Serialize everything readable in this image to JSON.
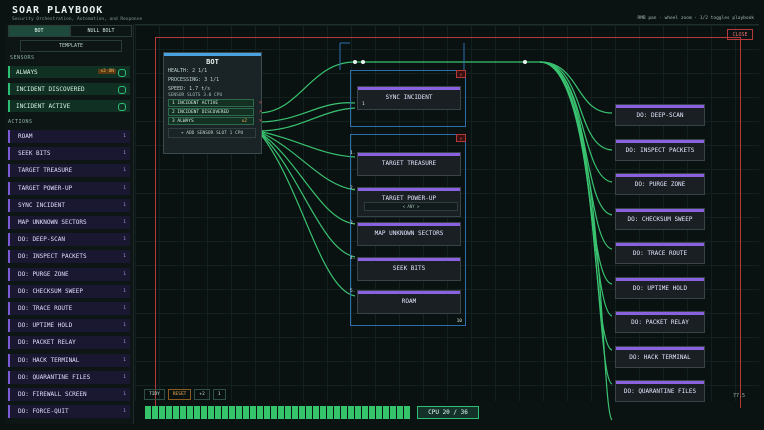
{
  "header": {
    "title": "SOAR PLAYBOOK",
    "subtitle": "Security Orchestration, Automation, and Response",
    "right": "RMB pan · wheel zoom · 1/2 toggles playbook",
    "close": "CLOSE"
  },
  "left": {
    "tabs": [
      "BOT",
      "NULL BOLT"
    ],
    "template": "TEMPLATE",
    "sensors_label": "SENSORS",
    "sensors": [
      {
        "label": "ALWAYS",
        "badge": "x2 ON"
      },
      {
        "label": "INCIDENT DISCOVERED"
      },
      {
        "label": "INCIDENT ACTIVE"
      }
    ],
    "actions_label": "ACTIONS",
    "actions": [
      "ROAM",
      "SEEK BITS",
      "TARGET TREASURE",
      "TARGET POWER-UP",
      "SYNC INCIDENT",
      "MAP UNKNOWN SECTORS",
      "DO: DEEP-SCAN",
      "DO: INSPECT PACKETS",
      "DO: PURGE ZONE",
      "DO: CHECKSUM SWEEP",
      "DO: TRACE ROUTE",
      "DO: UPTIME HOLD",
      "DO: PACKET RELAY",
      "DO: HACK TERMINAL",
      "DO: QUARANTINE FILES",
      "DO: FIREWALL SCREEN",
      "DO: FORCE-QUIT"
    ]
  },
  "bot": {
    "title": "BOT",
    "health": "HEALTH:  2   1/1",
    "processing": "PROCESSING:  3   1/1",
    "speed": "SPEED:  1.7 t/s",
    "slots_label": "SENSOR SLOTS  3.0 CPU",
    "slots": [
      "1  INCIDENT ACTIVE",
      "2  INCIDENT DISCOVERED",
      "3  ALWAYS"
    ],
    "always_badge": "x2",
    "add": "+ ADD SENSOR SLOT  1 CPU"
  },
  "mid": {
    "sync": {
      "title": "SYNC INCIDENT",
      "idx": "1"
    },
    "nodes": [
      {
        "idx": "1.",
        "title": "TARGET TREASURE"
      },
      {
        "idx": "2.",
        "title": "TARGET POWER-UP",
        "inline": "< ANY >"
      },
      {
        "idx": "3.",
        "title": "MAP UNKNOWN SECTORS"
      },
      {
        "idx": "4.",
        "title": "SEEK BITS"
      },
      {
        "idx": "5.",
        "title": "ROAM"
      }
    ],
    "count": "10"
  },
  "right": {
    "nodes": [
      "DO: DEEP-SCAN",
      "DO: INSPECT PACKETS",
      "DO: PURGE ZONE",
      "DO: CHECKSUM SWEEP",
      "DO: TRACE ROUTE",
      "DO: UPTIME HOLD",
      "DO: PACKET RELAY",
      "DO: HACK TERMINAL",
      "DO: QUARANTINE FILES"
    ]
  },
  "bottom": {
    "tidy": "TIDY",
    "reset": "RESET",
    "counter": "+2",
    "step": "1",
    "cpu": "CPU   20 / 36",
    "zoom": "77.5"
  },
  "cpu": {
    "used": 20,
    "total": 36
  }
}
